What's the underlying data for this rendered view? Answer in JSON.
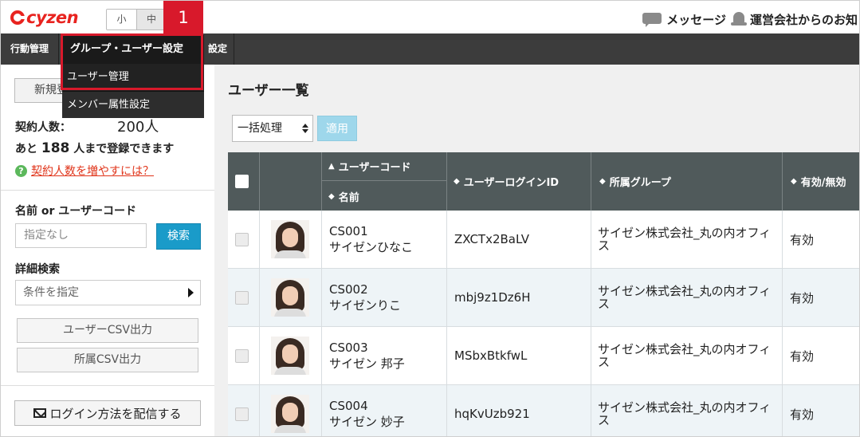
{
  "header": {
    "logo_text": "cyzen",
    "size_small": "小",
    "size_medium": "中",
    "messages": "メッセージ",
    "notice": "運営会社からのお知"
  },
  "nav": {
    "first": "行動管理",
    "settings": "設定"
  },
  "dropdown": {
    "title": "グループ・ユーザー設定",
    "items": [
      "ユーザー管理",
      "メンバー属性設定"
    ]
  },
  "annotation": {
    "step": "1",
    "color": "#d8192b"
  },
  "sidebar": {
    "new_button": "新規登録",
    "contract_label": "契約人数：",
    "contract_value": "200人",
    "remaining_prefix": "あと",
    "remaining_count": "188",
    "remaining_suffix": "人まで登録できます",
    "increase_link": "契約人数を増やすには？",
    "search_label": "名前 or ユーザーコード",
    "search_placeholder": "指定なし",
    "search_button": "検索",
    "detail_label": "詳細検索",
    "condition_select": "条件を指定",
    "csv_user": "ユーザーCSV出力",
    "csv_group": "所属CSV出力",
    "login_button": "ログイン方法を配信する"
  },
  "main": {
    "title": "ユーザー一覧",
    "bulk_select": "一括処理",
    "apply_button": "適用"
  },
  "table": {
    "headers": {
      "user_code": "ユーザーコード",
      "name": "名前",
      "login_id": "ユーザーログインID",
      "group": "所属グループ",
      "status": "有効/無効"
    },
    "rows": [
      {
        "code": "CS001",
        "name": "サイゼンひなこ",
        "login_id": "ZXCTx2BaLV",
        "group": "サイゼン株式会社_丸の内オフィス",
        "status": "有効"
      },
      {
        "code": "CS002",
        "name": "サイゼンりこ",
        "login_id": "mbj9z1Dz6H",
        "group": "サイゼン株式会社_丸の内オフィス",
        "status": "有効"
      },
      {
        "code": "CS003",
        "name": "サイゼン 邦子",
        "login_id": "MSbxBtkfwL",
        "group": "サイゼン株式会社_丸の内オフィス",
        "status": "有効"
      },
      {
        "code": "CS004",
        "name": "サイゼン 妙子",
        "login_id": "hqKvUzb921",
        "group": "サイゼン株式会社_丸の内オフィス",
        "status": "有効"
      }
    ]
  }
}
